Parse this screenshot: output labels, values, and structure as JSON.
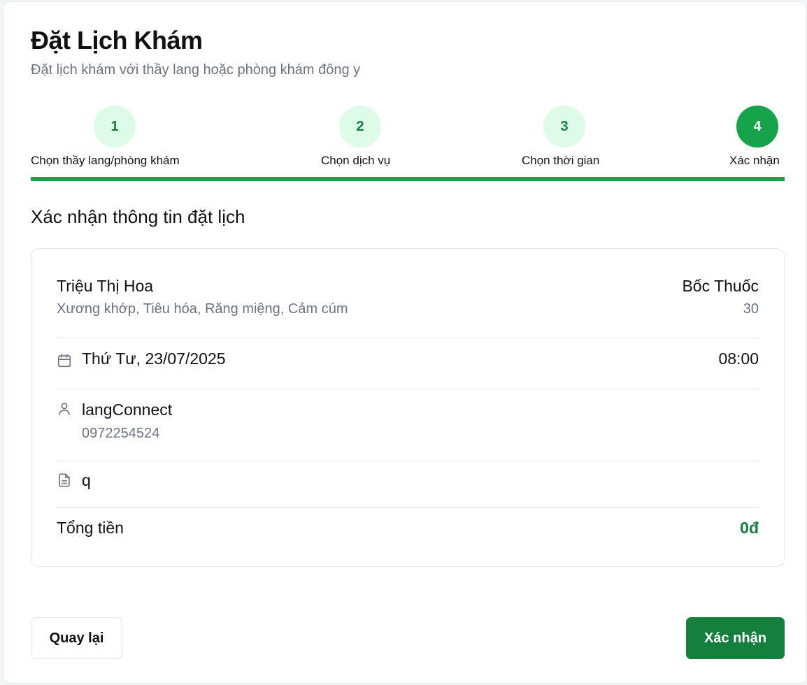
{
  "header": {
    "title": "Đặt Lịch Khám",
    "subtitle": "Đặt lịch khám với thầy lang hoặc phòng khám đông y"
  },
  "steps": [
    {
      "number": "1",
      "label": "Chọn thầy lang/phòng khám",
      "state": "done"
    },
    {
      "number": "2",
      "label": "Chọn dịch vụ",
      "state": "done"
    },
    {
      "number": "3",
      "label": "Chọn thời gian",
      "state": "done"
    },
    {
      "number": "4",
      "label": "Xác nhận",
      "state": "active"
    }
  ],
  "progress": {
    "percent": 100
  },
  "section_title": "Xác nhận thông tin đặt lịch",
  "summary": {
    "practitioner_name": "Triệu Thị Hoa",
    "specialties": "Xương khớp, Tiêu hóa, Răng miệng, Cảm cúm",
    "service_name": "Bốc Thuốc",
    "service_value": "30",
    "date": "Thứ Tư, 23/07/2025",
    "time": "08:00",
    "patient_name": "langConnect",
    "patient_phone": "0972254524",
    "note": "q",
    "total_label": "Tổng tiền",
    "total_value": "0đ"
  },
  "buttons": {
    "back": "Quay lại",
    "confirm": "Xác nhận"
  },
  "colors": {
    "accent": "#16a34a",
    "accent_dark": "#15803d",
    "step_done_bg": "#dcfce7"
  },
  "icons": {
    "date": "calendar-icon",
    "patient": "user-icon",
    "note": "document-icon"
  }
}
